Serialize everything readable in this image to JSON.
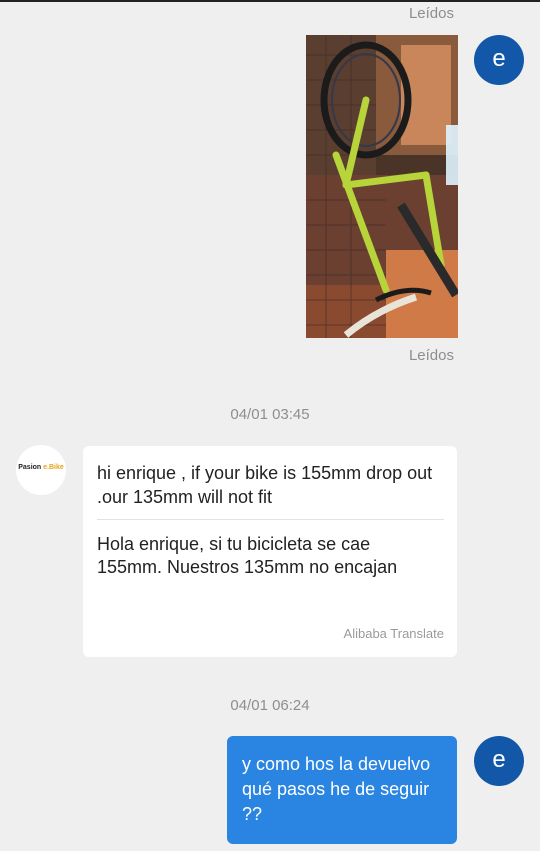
{
  "colors": {
    "background": "#efefef",
    "user_avatar": "#1257a8",
    "outgoing_bubble": "#2a84e2",
    "incoming_bubble": "#ffffff",
    "meta_text": "#8e8e8e",
    "logo_accent": "#e7a21b"
  },
  "messages": {
    "top_read_status": "Leídos",
    "photo": {
      "icon": "bicycle-photo",
      "read_status": "Leídos"
    },
    "user_avatar_letter": "e",
    "timestamp_1": "04/01 03:45",
    "incoming": {
      "sender_logo_main": "Pasion",
      "sender_logo_accent": "e.Bike",
      "original_text": "hi enrique , if your bike is 155mm drop out .our 135mm will not fit",
      "translated_text": "Hola enrique, si tu bicicleta se cae 155mm. Nuestros 135mm no encajan",
      "translator": "Alibaba Translate"
    },
    "timestamp_2": "04/01 06:24",
    "outgoing": {
      "text": "y como hos la devuelvo qué pasos he de seguir ??"
    }
  }
}
